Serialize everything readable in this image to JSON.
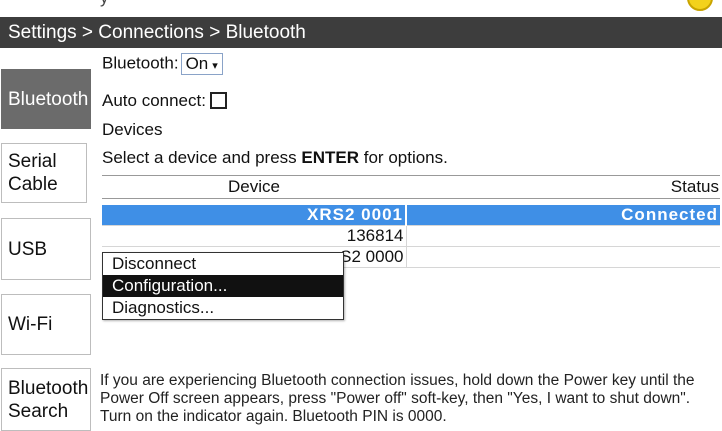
{
  "header": {
    "title": "Settings > Connections > Bluetooth",
    "topstrip_text": "y"
  },
  "sidebar": {
    "items": [
      {
        "label": "Bluetooth",
        "active": true
      },
      {
        "label": "Serial Cable",
        "active": false
      },
      {
        "label": "USB",
        "active": false
      },
      {
        "label": "Wi-Fi",
        "active": false
      },
      {
        "label": "Bluetooth Search",
        "active": false
      }
    ]
  },
  "bluetooth": {
    "label": "Bluetooth:",
    "value": "On",
    "auto_connect_label": "Auto connect:",
    "auto_connect_checked": false
  },
  "devices": {
    "section_label": "Devices",
    "instruction_prefix": "Select a device and press ",
    "instruction_key": "ENTER",
    "instruction_suffix": " for options.",
    "columns": [
      "Device",
      "Status"
    ],
    "rows": [
      {
        "device": "XRS2 0001",
        "status": "Connected",
        "selected": true
      },
      {
        "device": "136814",
        "status": "",
        "selected": false
      },
      {
        "device": "S2 0000",
        "status": "",
        "selected": false
      }
    ]
  },
  "context_menu": {
    "items": [
      {
        "label": "Disconnect",
        "highlighted": false
      },
      {
        "label": "Configuration...",
        "highlighted": true
      },
      {
        "label": "Diagnostics...",
        "highlighted": false
      }
    ]
  },
  "help_text": "If you are experiencing Bluetooth connection issues, hold down the Power key until the Power Off screen appears, press \"Power off\" soft-key, then \"Yes, I want to shut down\". Turn on the indicator again. Bluetooth PIN is 0000.",
  "colors": {
    "titlebar_bg": "#3d3d3d",
    "sidebar_active_bg": "#6b6b6b",
    "selection_blue": "#3f8fe6",
    "menu_highlight": "#111111"
  }
}
